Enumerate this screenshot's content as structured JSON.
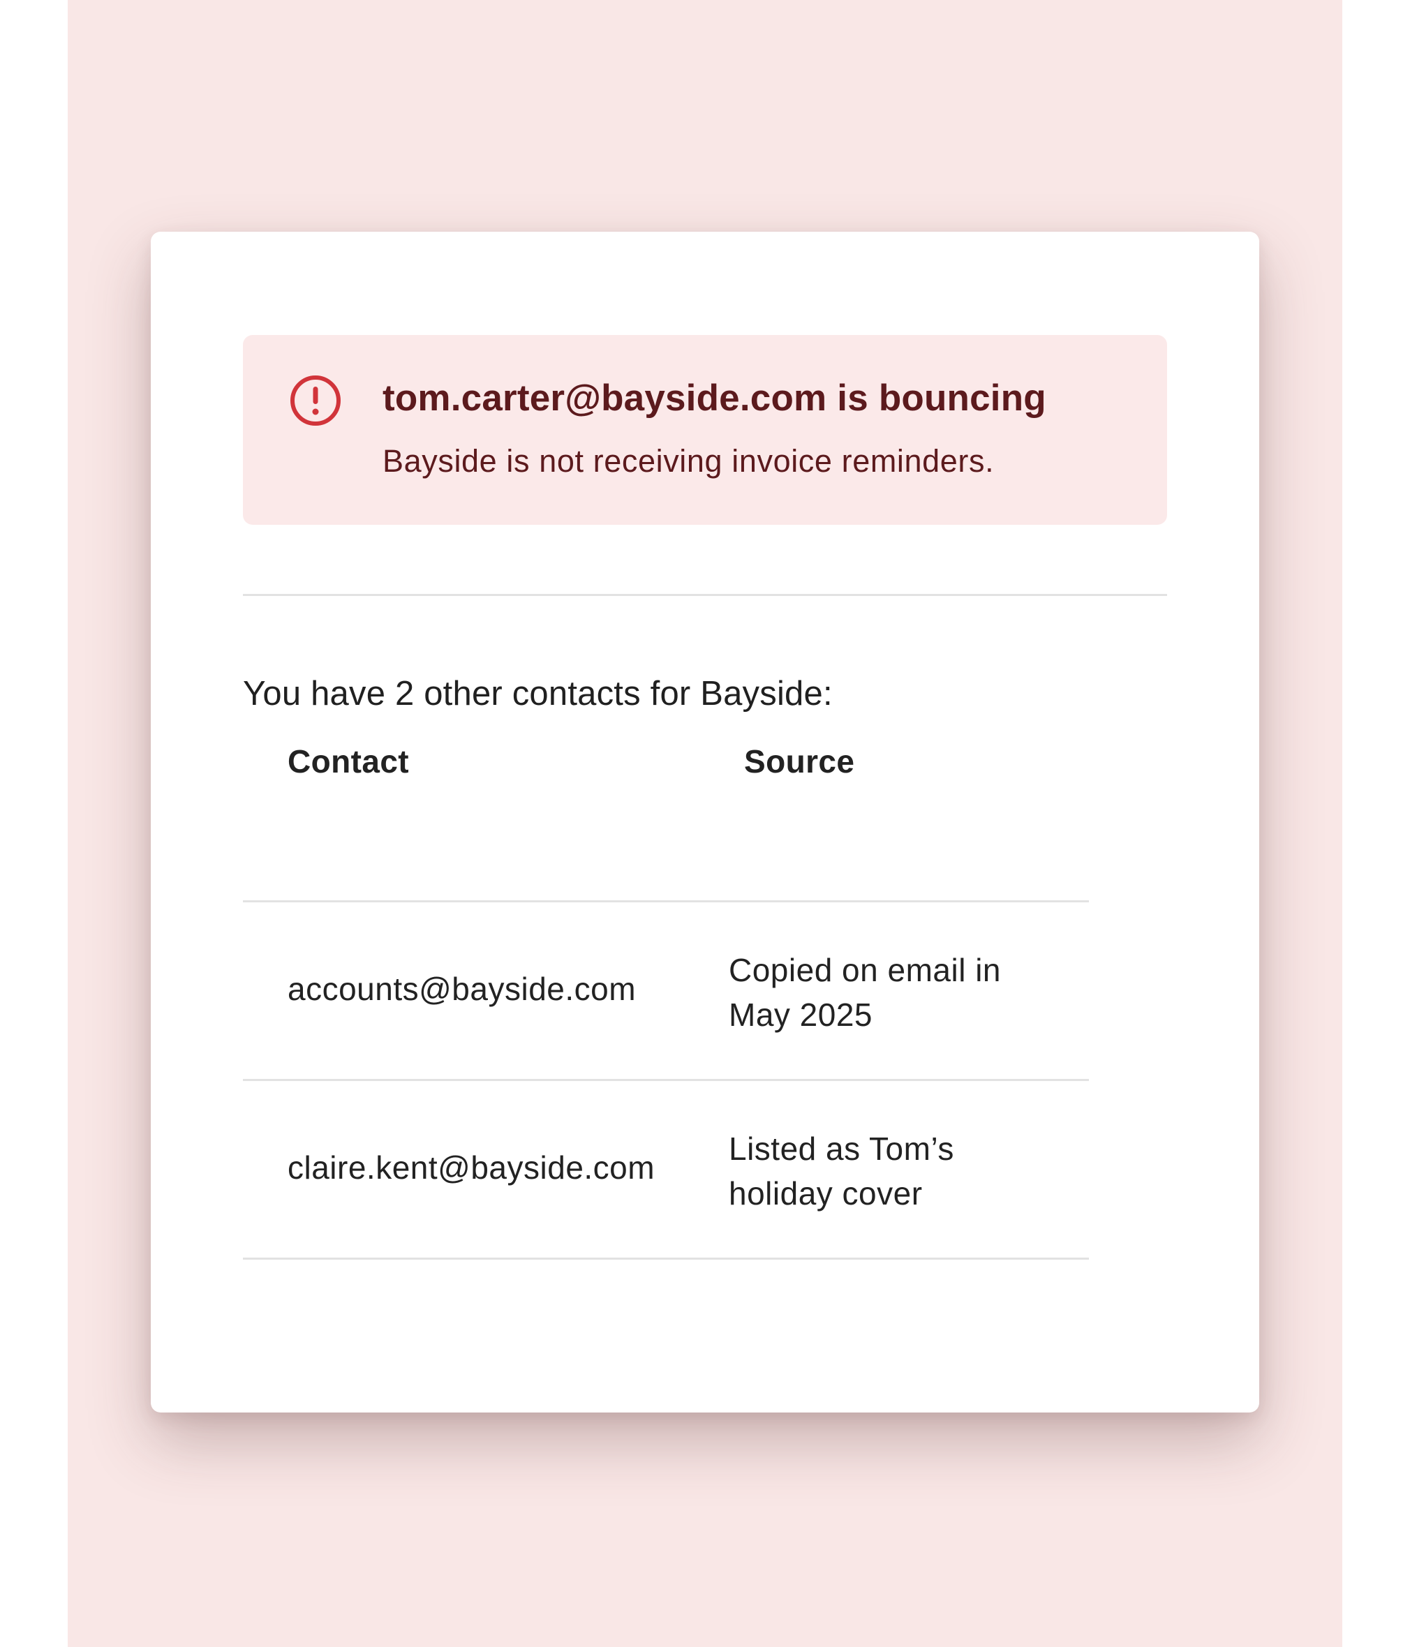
{
  "alert": {
    "icon": "alert-circle-icon",
    "title": "tom.carter@bayside.com is bouncing",
    "subtitle": "Bayside is not receiving invoice reminders."
  },
  "intro": "You have 2 other contacts for Bayside:",
  "table": {
    "columns": [
      "Contact",
      "Source"
    ],
    "rows": [
      {
        "contact": "accounts@bayside.com",
        "source": "Copied on email in May 2025"
      },
      {
        "contact": "claire.kent@bayside.com",
        "source": "Listed as Tom’s holiday cover"
      }
    ]
  },
  "colors": {
    "backdrop": "#f9e7e6",
    "alert_bg": "#fbe9e9",
    "alert_text": "#5c1a1d",
    "alert_icon": "#d1343a",
    "divider": "#e2e2e2",
    "text": "#222222"
  }
}
